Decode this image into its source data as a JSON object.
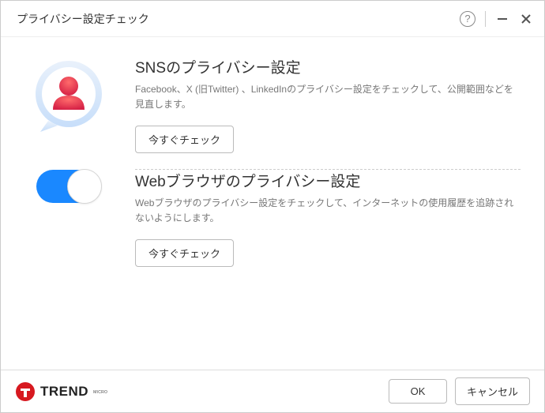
{
  "title": "プライバシー設定チェック",
  "sections": {
    "sns": {
      "heading": "SNSのプライバシー設定",
      "desc": "Facebook、X (旧Twitter) 、LinkedInのプライバシー設定をチェックして、公開範囲などを見直します。",
      "button": "今すぐチェック"
    },
    "browser": {
      "heading": "Webブラウザのプライバシー設定",
      "desc": "Webブラウザのプライバシー設定をチェックして、インターネットの使用履歴を追跡されないようにします。",
      "button": "今すぐチェック",
      "toggle_on": true
    }
  },
  "footer": {
    "brand": "TREND",
    "brand_sub": "MICRO",
    "ok": "OK",
    "cancel": "キャンセル"
  }
}
